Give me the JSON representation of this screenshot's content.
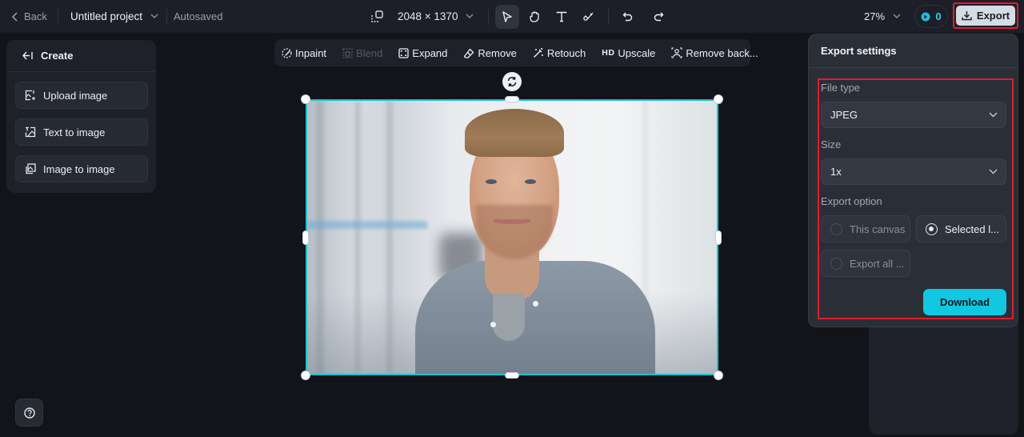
{
  "topbar": {
    "back_label": "Back",
    "project_name": "Untitled project",
    "save_status": "Autosaved",
    "canvas_size": "2048 × 1370",
    "tools": [
      {
        "name": "select",
        "icon": "cursor-icon",
        "active": true
      },
      {
        "name": "pan",
        "icon": "hand-icon",
        "active": false
      },
      {
        "name": "text",
        "icon": "text-icon",
        "active": false
      },
      {
        "name": "brush",
        "icon": "brush-icon",
        "active": false
      }
    ],
    "zoom_level": "27%",
    "credits": "0",
    "export_label": "Export"
  },
  "create_panel": {
    "title": "Create",
    "items": [
      {
        "label": "Upload image",
        "icon": "upload-image-icon"
      },
      {
        "label": "Text to image",
        "icon": "text-to-image-icon"
      },
      {
        "label": "Image to image",
        "icon": "image-to-image-icon"
      }
    ]
  },
  "edit_toolbar": {
    "items": [
      {
        "label": "Inpaint",
        "icon": "inpaint-icon",
        "enabled": true
      },
      {
        "label": "Blend",
        "icon": "blend-icon",
        "enabled": false
      },
      {
        "label": "Expand",
        "icon": "expand-icon",
        "enabled": true
      },
      {
        "label": "Remove",
        "icon": "eraser-icon",
        "enabled": true
      },
      {
        "label": "Retouch",
        "icon": "magic-wand-icon",
        "enabled": true
      },
      {
        "label": "Upscale",
        "icon": "hd-icon",
        "icon_text": "HD",
        "enabled": true
      },
      {
        "label": "Remove back...",
        "icon": "remove-background-icon",
        "enabled": true
      }
    ]
  },
  "export_settings": {
    "title": "Export settings",
    "file_type_label": "File type",
    "file_type_value": "JPEG",
    "size_label": "Size",
    "size_value": "1x",
    "export_option_label": "Export option",
    "options": [
      {
        "label": "This canvas",
        "selected": false
      },
      {
        "label": "Selected l...",
        "selected": true
      },
      {
        "label": "Export all ...",
        "selected": false
      }
    ],
    "download_label": "Download"
  },
  "colors": {
    "accent": "#12c8e0",
    "selection_border": "#19c3cf",
    "highlight_red": "#e11d2a",
    "export_button_bg": "#d4dde4"
  }
}
